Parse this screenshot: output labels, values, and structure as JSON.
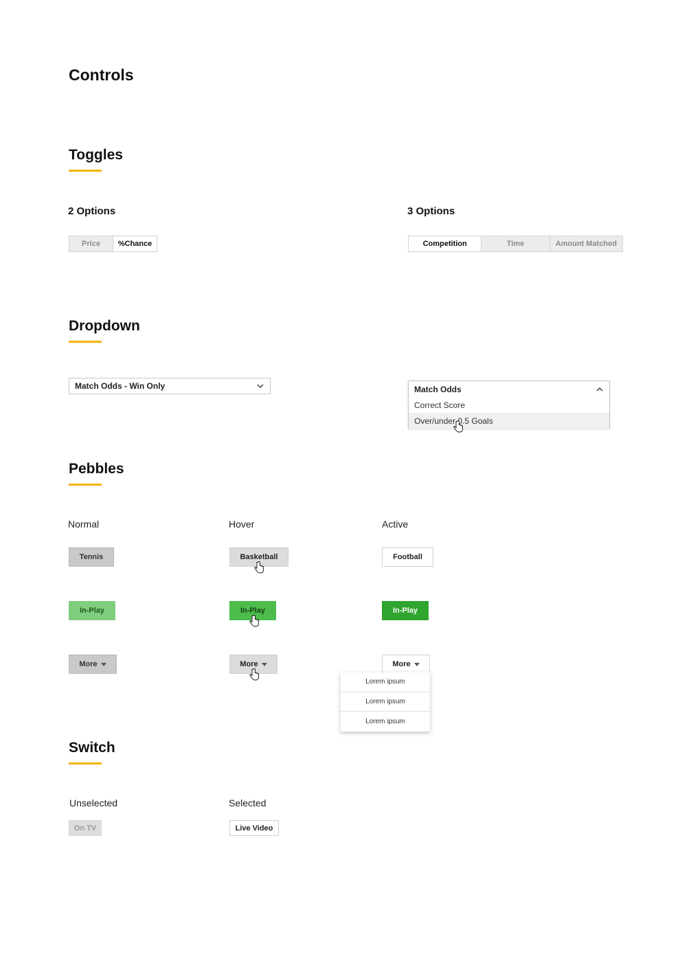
{
  "page": {
    "title": "Controls"
  },
  "toggles": {
    "title": "Toggles",
    "two": {
      "title": "2 Options",
      "options": [
        "Price",
        "%Chance"
      ],
      "active_index": 1
    },
    "three": {
      "title": "3 Options",
      "options": [
        "Competition",
        "Time",
        "Amount Matched"
      ],
      "active_index": 0
    }
  },
  "dropdown": {
    "title": "Dropdown",
    "closed": {
      "value": "Match Odds - Win Only",
      "icon": "chevron-down-icon"
    },
    "open": {
      "selected": "Match Odds",
      "options": [
        "Correct Score",
        "Over/under 0.5 Goals"
      ],
      "hovered_index": 1,
      "icon": "chevron-up-icon"
    }
  },
  "pebbles": {
    "title": "Pebbles",
    "states": [
      "Normal",
      "Hover",
      "Active"
    ],
    "row1": [
      "Tennis",
      "Basketball",
      "Football"
    ],
    "row2": [
      "In-Play",
      "In-Play",
      "In-Play"
    ],
    "row3": [
      "More",
      "More",
      "More"
    ],
    "menu_items": [
      "Lorem ipsum",
      "Lorem ipsum",
      "Lorem ipsum"
    ],
    "colors": {
      "green_normal": "#7fce7f",
      "green_hover": "#4cbc4c",
      "green_active": "#2fa52f"
    }
  },
  "switch": {
    "title": "Switch",
    "states": [
      "Unselected",
      "Selected"
    ],
    "unselected_label": "On TV",
    "selected_label": "Live Video"
  },
  "colors": {
    "accent": "#f5b300"
  }
}
